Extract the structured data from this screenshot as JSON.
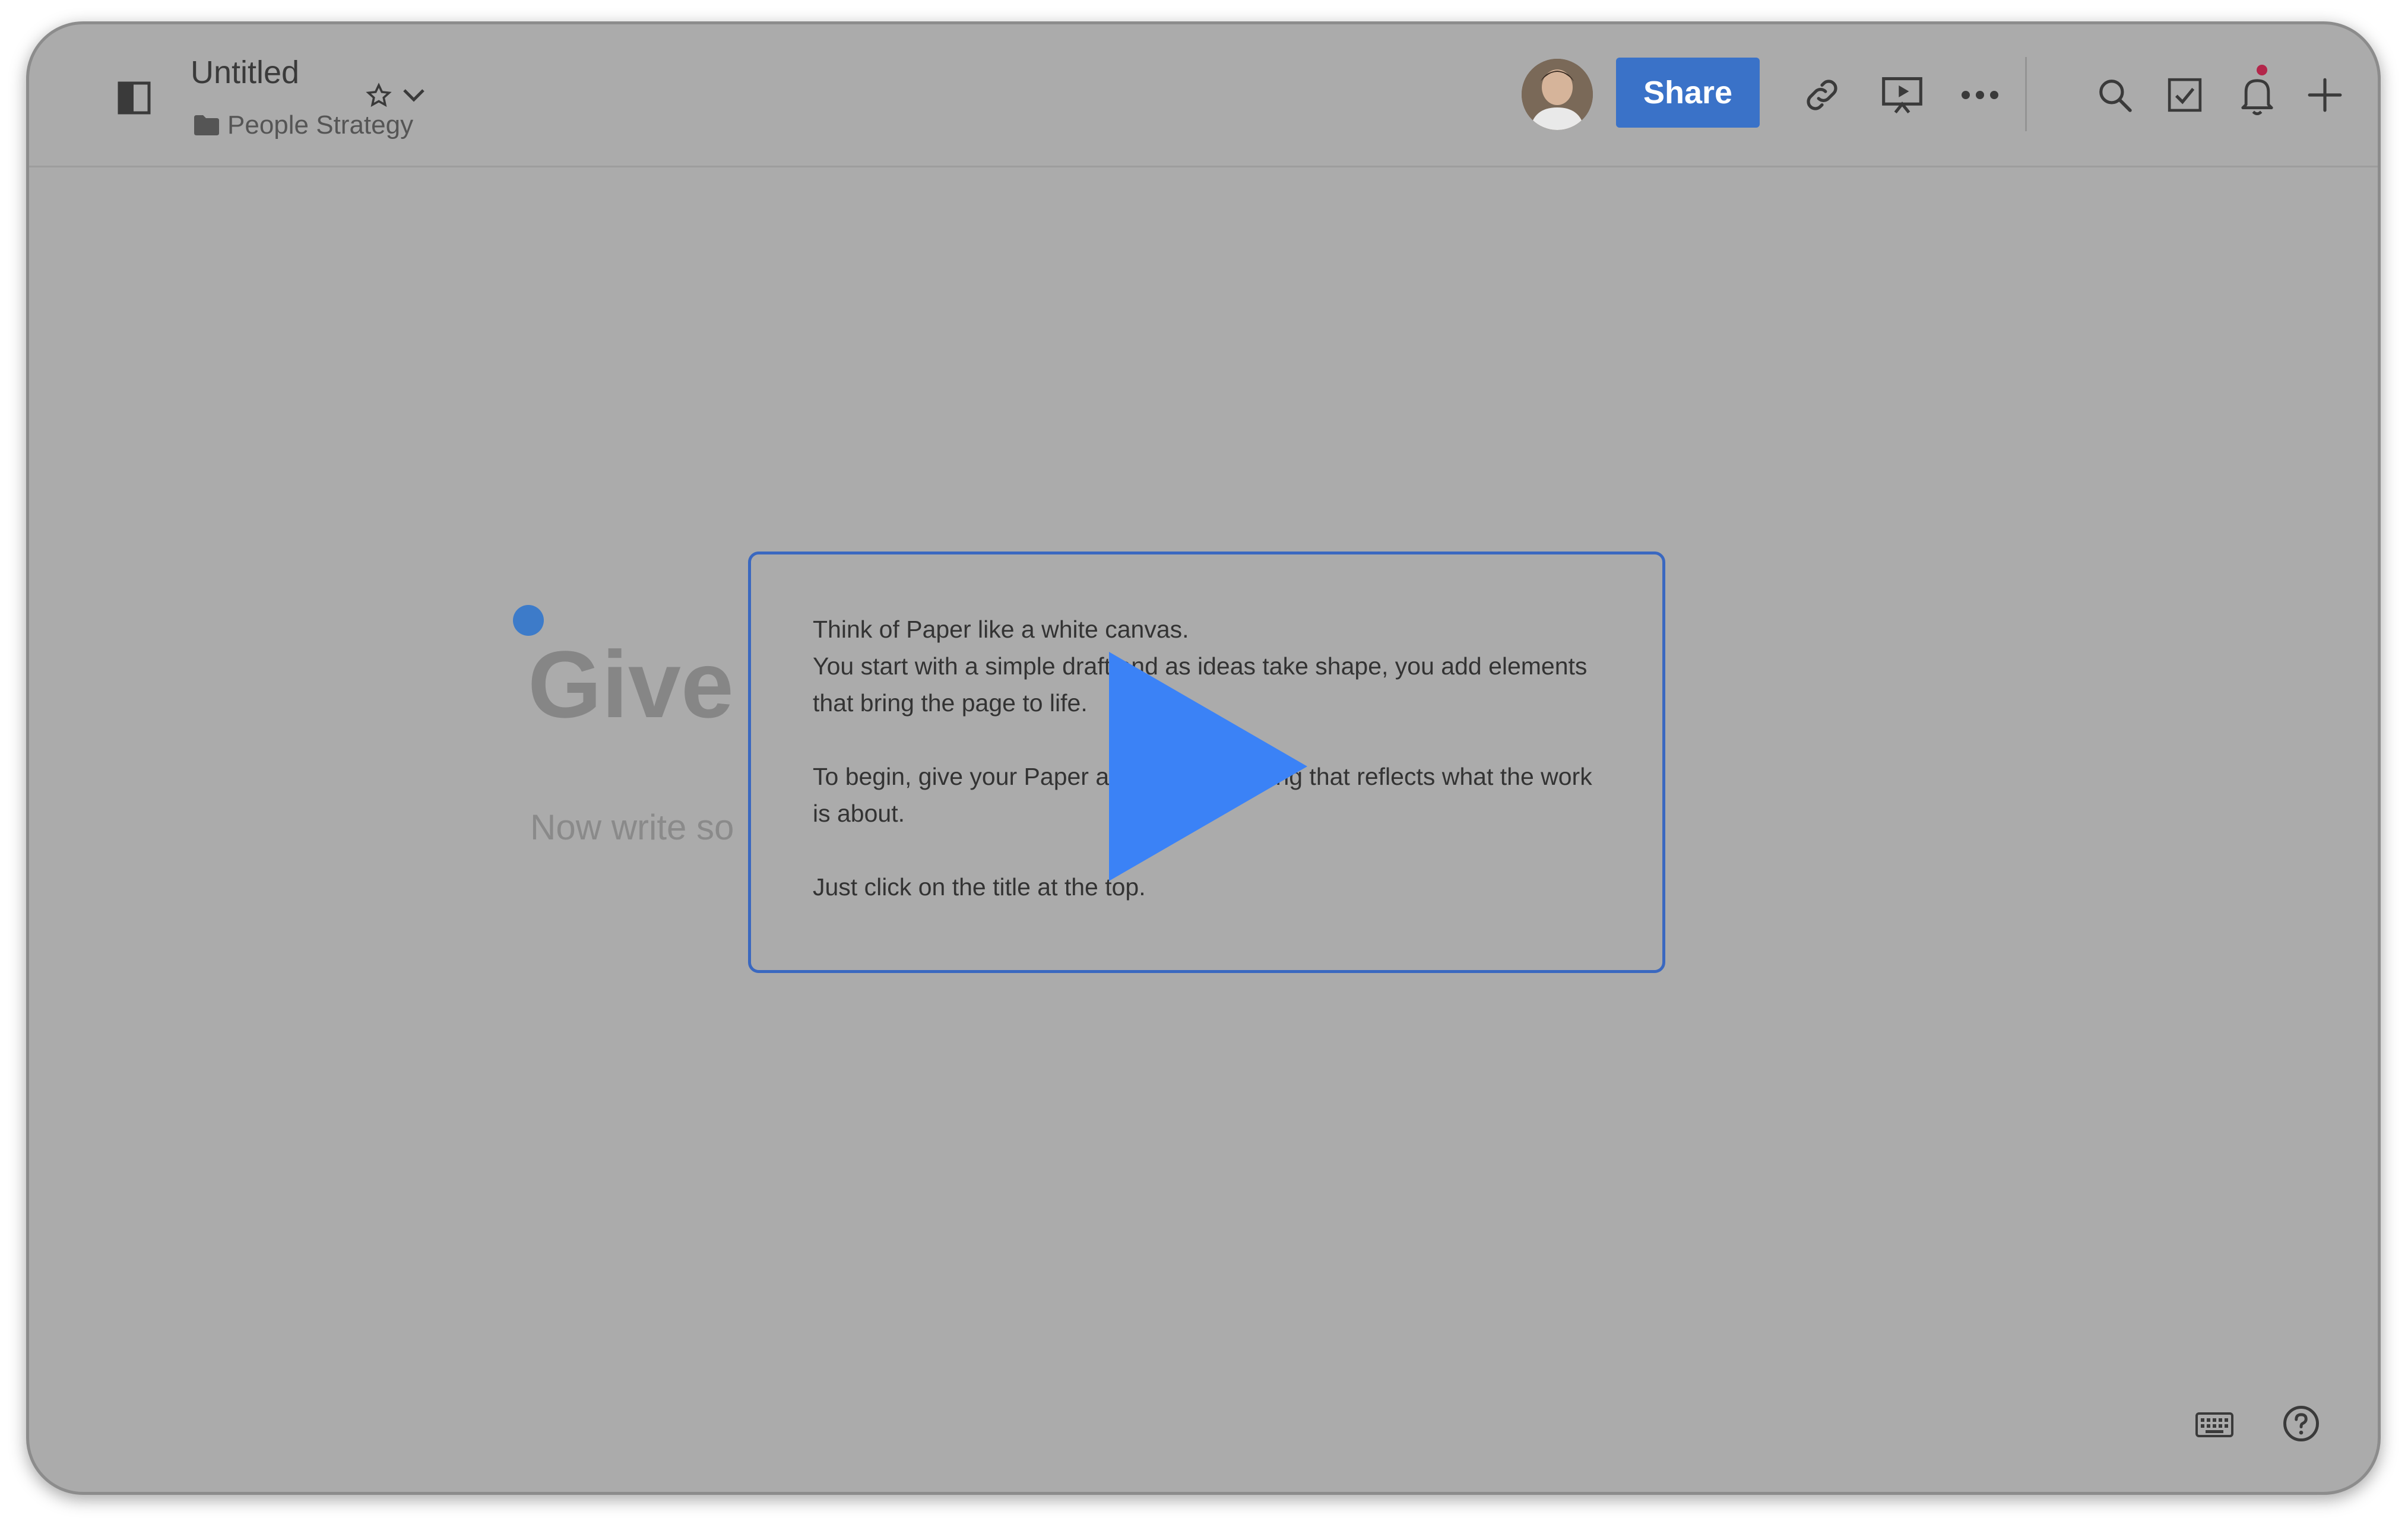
{
  "header": {
    "doc_title": "Untitled",
    "folder": "People Strategy",
    "share_label": "Share"
  },
  "editor": {
    "title_placeholder": "Give",
    "body_placeholder": "Now write so"
  },
  "tip": {
    "paragraphs": [
      "Think of Paper like a white canvas.\nYou start with a simple draft and as ideas take shape, you add elements that bring the page to life.",
      "To begin, give your Paper a name, something that reflects what the work is about.",
      "Just click on the title at the top."
    ]
  },
  "icons": {
    "sidebar": "sidebar-toggle-icon",
    "star": "star-icon",
    "chevron": "chevron-down-icon",
    "link": "link-icon",
    "present": "present-icon",
    "more": "more-icon",
    "search": "search-icon",
    "tasks": "checkbox-icon",
    "bell": "bell-icon",
    "plus": "plus-icon",
    "keyboard": "keyboard-icon",
    "help": "help-icon",
    "play": "play-icon"
  },
  "colors": {
    "accent": "#3a72c8",
    "overlay": "#ababab",
    "play": "#3b82f6",
    "notification": "#b3264a"
  }
}
